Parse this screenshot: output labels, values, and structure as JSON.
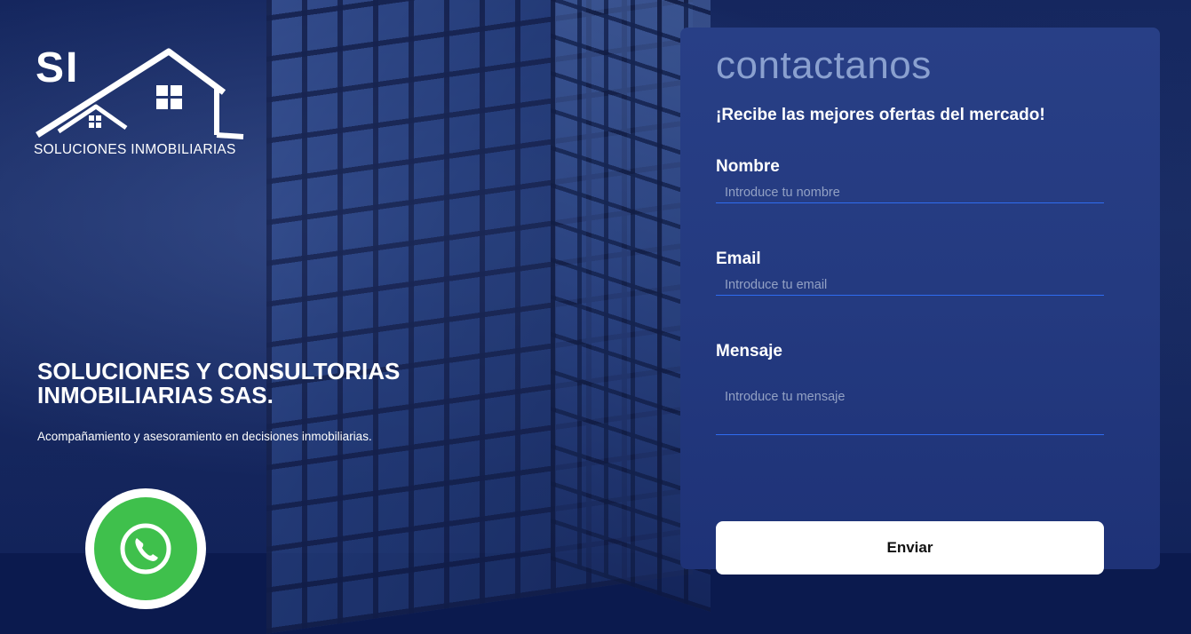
{
  "brand": {
    "mark": "SI",
    "name": "SOLUCIONES INMOBILIARIAS"
  },
  "hero": {
    "headline_line1": "SOLUCIONES Y CONSULTORIAS",
    "headline_line2": "INMOBILIARIAS SAS.",
    "tagline": "Acompañamiento y asesoramiento en decisiones inmobiliarias."
  },
  "contact_form": {
    "title": "contactanos",
    "subtitle": "¡Recibe las mejores ofertas del mercado!",
    "name_label": "Nombre",
    "name_placeholder": "Introduce tu nombre",
    "email_label": "Email",
    "email_placeholder": "Introduce tu email",
    "message_label": "Mensaje",
    "message_placeholder": "Introduce tu mensaje",
    "submit_label": "Enviar"
  },
  "icons": {
    "logo": "house-roof-logo-icon",
    "whatsapp": "whatsapp-icon"
  },
  "colors": {
    "panel": "#253c82",
    "field_underline": "#2f6cf0",
    "whatsapp_green": "#3fc04c",
    "title_muted": "#8aa0cf"
  }
}
